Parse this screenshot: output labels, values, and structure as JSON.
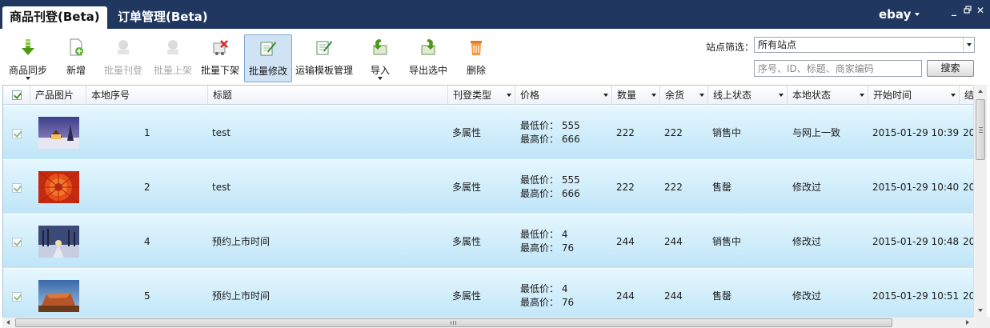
{
  "tabs": [
    {
      "label": "商品刊登(Beta)"
    },
    {
      "label": "订单管理(Beta)"
    }
  ],
  "brand": {
    "label": "ebay"
  },
  "window_controls": {
    "minimize": "_",
    "restore": "▫",
    "close": "✕"
  },
  "toolbar": {
    "buttons": [
      {
        "label": "商品同步",
        "icon": "sync-arrow-icon",
        "enabled": true,
        "dropdown": true
      },
      {
        "label": "新增",
        "icon": "add-document-icon",
        "enabled": true
      },
      {
        "label": "批量刊登",
        "icon": "batch-publish-icon",
        "enabled": false
      },
      {
        "label": "批量上架",
        "icon": "batch-list-icon",
        "enabled": false
      },
      {
        "label": "批量下架",
        "icon": "batch-delist-icon",
        "enabled": true
      },
      {
        "label": "批量修改",
        "icon": "batch-edit-icon",
        "enabled": true,
        "pressed": true
      },
      {
        "label": "运输模板管理",
        "icon": "shipping-template-icon",
        "enabled": true
      },
      {
        "label": "导入",
        "icon": "import-icon",
        "enabled": true,
        "dropdown": true
      },
      {
        "label": "导出选中",
        "icon": "export-icon",
        "enabled": true
      },
      {
        "label": "删除",
        "icon": "trash-icon",
        "enabled": true
      }
    ]
  },
  "filter": {
    "site_label": "站点筛选：",
    "site_value": "所有站点",
    "search_placeholder": "序号、ID、标题、商家编码",
    "search_button": "搜索"
  },
  "grid": {
    "columns": [
      "产品图片",
      "本地序号",
      "标题",
      "刊登类型",
      "价格",
      "数量",
      "余货",
      "线上状态",
      "本地状态",
      "开始时间",
      "结"
    ],
    "price_labels": {
      "min": "最低价：",
      "max": "最高价："
    },
    "rows": [
      {
        "seq": "1",
        "title": "test",
        "listing_type": "多属性",
        "min_price": "555",
        "max_price": "666",
        "quantity": "222",
        "stock": "222",
        "online_status": "销售中",
        "local_status": "与网上一致",
        "start_time": "2015-01-29 10:39",
        "end_time_partial": "20",
        "thumb": "winter-cabin"
      },
      {
        "seq": "2",
        "title": "test",
        "listing_type": "多属性",
        "min_price": "555",
        "max_price": "666",
        "quantity": "222",
        "stock": "222",
        "online_status": "售罄",
        "local_status": "修改过",
        "start_time": "2015-01-29 10:40",
        "end_time_partial": "20",
        "thumb": "red-flower"
      },
      {
        "seq": "4",
        "title": "预约上市时间",
        "listing_type": "多属性",
        "min_price": "4",
        "max_price": "76",
        "quantity": "244",
        "stock": "244",
        "online_status": "销售中",
        "local_status": "修改过",
        "start_time": "2015-01-29 10:48",
        "end_time_partial": "20",
        "thumb": "snowy-forest"
      },
      {
        "seq": "5",
        "title": "预约上市时间",
        "listing_type": "多属性",
        "min_price": "4",
        "max_price": "76",
        "quantity": "244",
        "stock": "244",
        "online_status": "售罄",
        "local_status": "修改过",
        "start_time": "2015-01-29 10:51",
        "end_time_partial": "20",
        "thumb": "desert-rock"
      }
    ]
  },
  "colors": {
    "titlebar": "#203760",
    "row_gradient_top": "#e6f6fd",
    "row_gradient_bottom": "#bfe5f8",
    "selected_button": "#cfe3f5"
  }
}
